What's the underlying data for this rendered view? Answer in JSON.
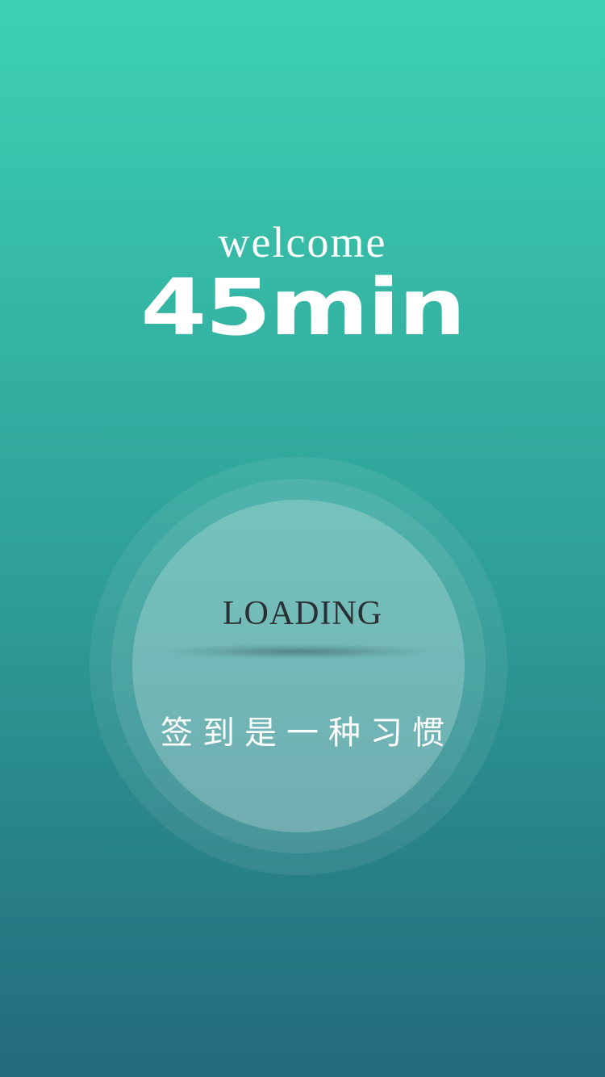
{
  "splash": {
    "welcome_text": "welcome",
    "brand_text": "45min"
  },
  "loader": {
    "loading_text": "LOADING",
    "slogan": "签到是一种习惯"
  },
  "colors": {
    "gradient_top": "#3dd1b3",
    "gradient_bottom": "#246a7c",
    "text": "#ffffff",
    "loading_text": "#2a2f34"
  }
}
